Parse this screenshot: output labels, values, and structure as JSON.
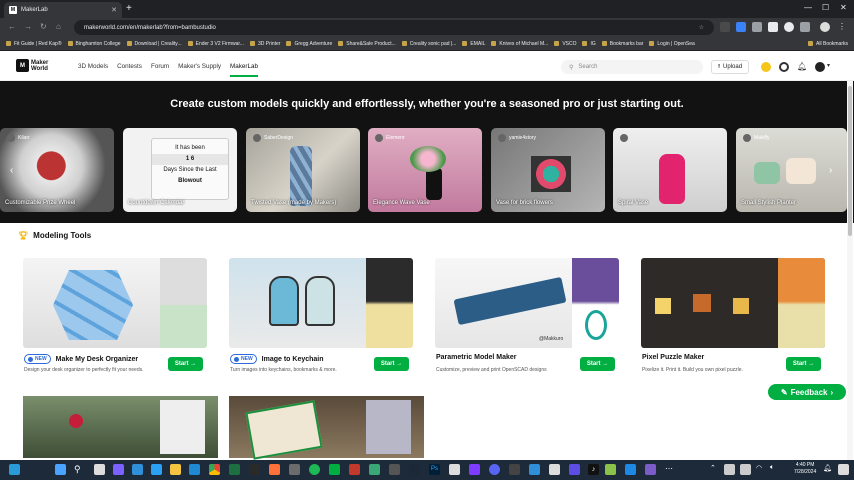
{
  "browser": {
    "tab_title": "MakerLab",
    "url": "makerworld.com/en/makerlab?from=bambustudio",
    "bookmarks": [
      "Fit Guide | Red Kap®",
      "Binghamton College",
      "Download | Creality...",
      "Ender 3 V2 Firmwar...",
      "3D Printer",
      "Gregg Adventure",
      "Share&Sale Product...",
      "Creality sonic pad |...",
      "EMAIL",
      "Knives of Michael M...",
      "VSCO",
      "IG",
      "Bookmarks bar",
      "Login | OpenSea",
      "All Bookmarks"
    ]
  },
  "site": {
    "logo_line1": "Maker",
    "logo_line2": "World",
    "nav": [
      "3D Models",
      "Contests",
      "Forum",
      "Maker's Supply",
      "MakerLab"
    ],
    "active_nav": "MakerLab",
    "search_placeholder": "Search",
    "upload_label": "Upload"
  },
  "hero": {
    "headline": "Create custom models quickly and effortlessly, whether you're a seasoned pro or just starting out.",
    "cards": [
      {
        "title": "Customizable Prize Wheel",
        "author": "Kilarr"
      },
      {
        "title": "Countdown Calendar",
        "author": ""
      },
      {
        "title": "Twisted Vase (made by Makers)",
        "author": "SaberDesign"
      },
      {
        "title": "Elegance Wave Vase",
        "author": "Elemenr"
      },
      {
        "title": "Vase for brick flowers",
        "author": "yamie4story"
      },
      {
        "title": "Spiral Vase",
        "author": ""
      },
      {
        "title": "Small Stylish Planter",
        "author": "Makilfy"
      }
    ],
    "card2_sign": {
      "line1": "It has been",
      "number": "1 6",
      "line2": "Days Since the Last",
      "line3": "Blowout"
    }
  },
  "modeling_tools": {
    "title": "Modeling Tools",
    "new_label": "NEW",
    "start_label": "Start",
    "tools": [
      {
        "name": "Make My Desk Organizer",
        "desc": "Design your desk organizer to perfectly fit your needs.",
        "is_new": true
      },
      {
        "name": "Image to Keychain",
        "desc": "Turn images into keychains, bookmarks & more.",
        "is_new": true
      },
      {
        "name": "Parametric Model Maker",
        "desc": "Customize, preview and print OpenSCAD designs",
        "is_new": false,
        "credit": "@Makkuro"
      },
      {
        "name": "Pixel Puzzle Maker",
        "desc": "Pixelize it. Print it. Build you own pixel puzzle.",
        "is_new": false
      }
    ]
  },
  "feedback_label": "Feedback",
  "taskbar": {
    "time": "4:40 PM",
    "date": "7/28/2024"
  },
  "colors": {
    "accent": "#00ae42",
    "hero_bg": "#121212",
    "new_badge": "#2d6bdb"
  }
}
